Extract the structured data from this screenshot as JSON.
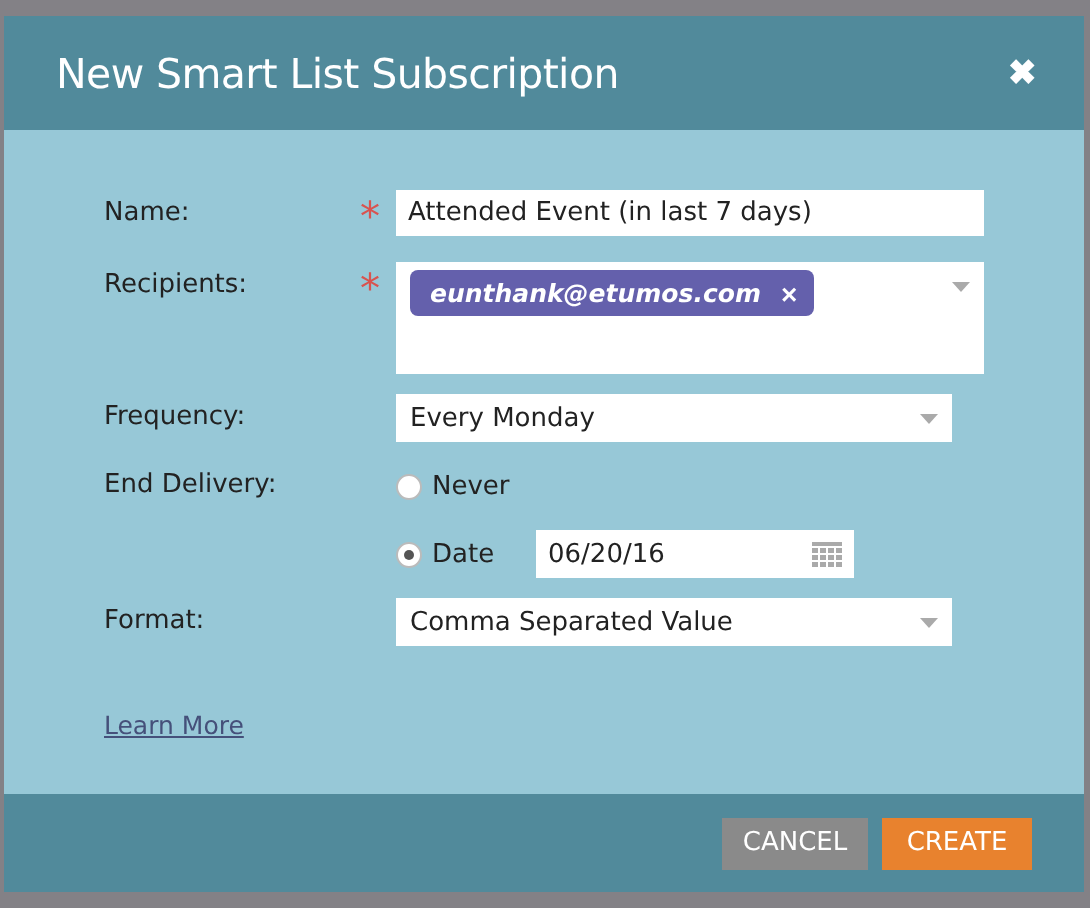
{
  "dialog": {
    "title": "New Smart List Subscription",
    "close": "✖"
  },
  "fields": [
    {
      "kind": "text",
      "label": "Name:",
      "required_mark": "*",
      "value": "Attended Event (in last 7 days)"
    },
    {
      "kind": "tags",
      "label": "Recipients:",
      "required_mark": "*",
      "tags": [
        {
          "text": "eunthank@etumos.com",
          "remove": "×"
        }
      ]
    },
    {
      "kind": "select",
      "label": "Frequency:",
      "value": "Every Monday"
    },
    {
      "kind": "radio",
      "label": "End Delivery:",
      "options": [
        {
          "label": "Never",
          "selected": false
        },
        {
          "label": "Date",
          "selected": true,
          "date": "06/20/16"
        }
      ]
    },
    {
      "kind": "select",
      "label": "Format:",
      "value": "Comma Separated Value"
    }
  ],
  "link": "Learn More",
  "buttons": [
    {
      "kind": "secondary",
      "label": "CANCEL"
    },
    {
      "kind": "primary",
      "label": "CREATE"
    }
  ]
}
